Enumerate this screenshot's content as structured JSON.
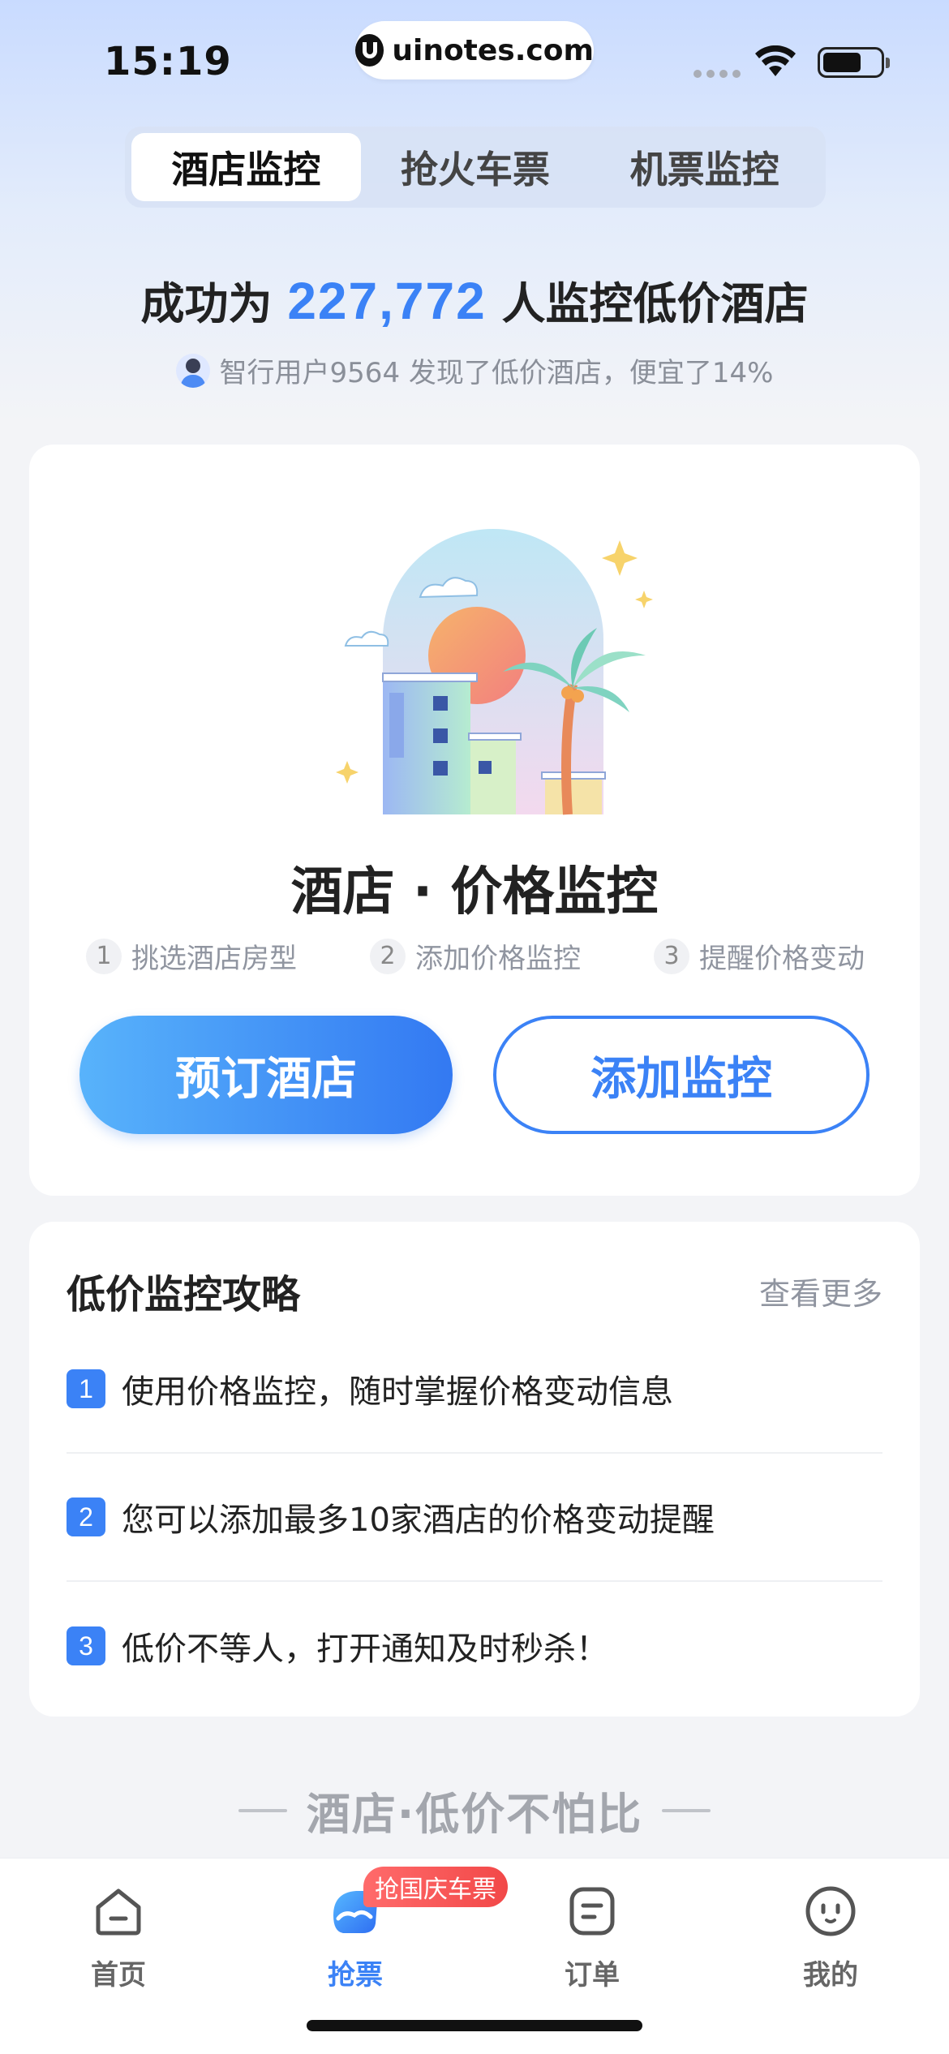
{
  "status_bar": {
    "time": "15:19",
    "url": "uinotes.com"
  },
  "tabs": [
    {
      "label": "酒店监控",
      "active": true
    },
    {
      "label": "抢火车票",
      "active": false
    },
    {
      "label": "机票监控",
      "active": false
    }
  ],
  "headline": {
    "prefix": "成功为",
    "count": "227,772",
    "suffix": "人监控低价酒店"
  },
  "subline": {
    "text": "智行用户9564 发现了低价酒店，便宜了14%"
  },
  "main_card": {
    "title": "酒店 · 价格监控",
    "steps": [
      {
        "num": "1",
        "label": "挑选酒店房型"
      },
      {
        "num": "2",
        "label": "添加价格监控"
      },
      {
        "num": "3",
        "label": "提醒价格变动"
      }
    ],
    "primary_button": "预订酒店",
    "secondary_button": "添加监控"
  },
  "tips_card": {
    "title": "低价监控攻略",
    "more": "查看更多",
    "items": [
      {
        "num": "1",
        "text": "使用价格监控，随时掌握价格变动信息"
      },
      {
        "num": "2",
        "text": "您可以添加最多10家酒店的价格变动提醒"
      },
      {
        "num": "3",
        "text": "低价不等人，打开通知及时秒杀！"
      }
    ]
  },
  "slogan": "酒店·低价不怕比",
  "bottom_nav": {
    "badge": "抢国庆车票",
    "items": [
      {
        "label": "首页",
        "icon": "home-icon",
        "active": false
      },
      {
        "label": "抢票",
        "icon": "ticket-icon",
        "active": true
      },
      {
        "label": "订单",
        "icon": "order-icon",
        "active": false
      },
      {
        "label": "我的",
        "icon": "profile-icon",
        "active": false
      }
    ]
  },
  "colors": {
    "accent": "#3b82f6",
    "badge": "#f24848"
  }
}
